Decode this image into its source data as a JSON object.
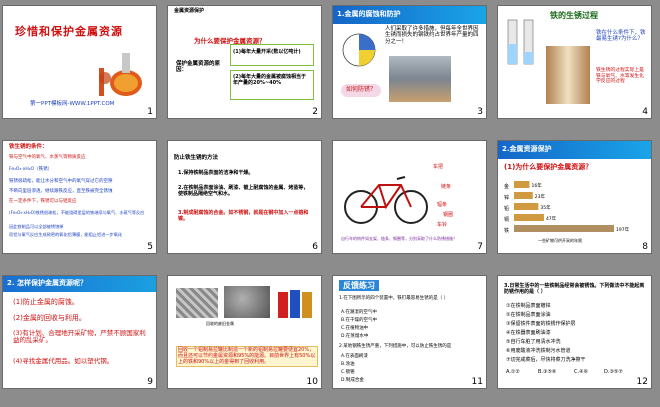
{
  "slides": [
    {
      "num": "1",
      "title": "珍惜和保护金属资源",
      "footer": "第一PPT模板网-WWW.1PPT.COM"
    },
    {
      "num": "2",
      "heading": "金属资源保护",
      "question": "为什么要保护金属资源？",
      "reason_label": "保护金属资源的原因：",
      "reason1": "(1)每年大量开采(数以亿吨计)",
      "reason2": "(2)每年大量的金属被腐蚀相当于年产量的20%~40%"
    },
    {
      "num": "3",
      "heading": "1.金属的腐蚀和防护",
      "text": "人们采取了许多措施，但每年全世界因生锈而损失的钢铁约占世界年产量的四分之一！",
      "callout": "如何防锈？"
    },
    {
      "num": "4",
      "heading": "铁的生锈过程",
      "q": "铁在什么条件下，铁最易生锈?为什么？",
      "caption": "铁生锈的过程实际上是铁与氧气、水等发生化学反应的过程"
    },
    {
      "num": "5",
      "heading": "铁生锈的条件：",
      "lines": [
        "铁与空气中的氧气、水蒸气等物质反应",
        "Fe₂O₃·xH₂O（铁锈）",
        "铁锈很疏松，能让水分和空气中的氧气穿过它的空隙",
        "不断向里层渗透，继续跟铁反应，直至铁被完全锈蚀",
        "在一定条件下，铁锈可以与铝反应",
        "(Fe₂O₃·xH₂O)铁锈很疏松，不能阻碍里层的铁继续与氧气、水蒸气等反应",
        "因此铁制品可以全部被锈蚀掉",
        "而铝与氧气反应生成致密的氧化铝薄膜，能阻止铝进一步氧化"
      ]
    },
    {
      "num": "6",
      "heading": "防止铁生锈的方法",
      "lines": [
        "1.保持铁制品表面的洁净和干燥。",
        "2.在铁制品表面涂油、刷漆、镀上耐腐蚀的金属、烤蓝等，使铁制品隔绝空气和水。",
        "3.制成耐腐蚀的合金。如不锈钢，就是在钢中加入一点铬和镍。"
      ]
    },
    {
      "num": "7",
      "labels": [
        "链条",
        "车把",
        "辐条",
        "钢圈",
        "车铃"
      ],
      "question": "自行车的构件如支架、链条、钢圈等，分别采取了什么防锈措施？"
    },
    {
      "num": "8",
      "heading": "2.金属资源保护",
      "question": "(1)为什么要保护金属资源？",
      "bars": [
        {
          "label": "金",
          "value": "16年"
        },
        {
          "label": "锌",
          "value": "23年"
        },
        {
          "label": "铅",
          "value": "35年"
        },
        {
          "label": "铜",
          "value": "47年"
        },
        {
          "label": "铁",
          "value": "197年"
        }
      ],
      "caption": "一些矿物可供开采的年限"
    },
    {
      "num": "9",
      "heading": "2. 怎样保护金属资源呢？",
      "items": [
        "(1)防止金属的腐蚀。",
        "(2)金属的回收与利用。",
        "(3)有计划、合理地开采矿物，严禁不顾国家利益的乱采矿。",
        "(4)寻找金属代用品。如以塑代钢。"
      ]
    },
    {
      "num": "10",
      "caption": "回收的废旧金属",
      "text": "回收一个铝制易拉罐比制造一个新的铝制易拉罐要便宜20%，而且还可以节约金属资源和95%的能源。目前世界上有50%以上的铁和90%以上的金得到了回收利用。"
    },
    {
      "num": "11",
      "heading": "反馈练习",
      "q1": "1.在下图所示的四个装置中，铁钉最容易生锈的是（ ）",
      "opts": [
        "A.在潮湿的空气中",
        "B.在干燥的空气中",
        "C.在植物油中",
        "D.在蒸馏水中"
      ],
      "q2": "2.某地钢铁生锈严重，下列措施中，可以防止铁生锈的是",
      "opts2": [
        "A.在表面刷漆",
        "B.涂油",
        "C.镀铬",
        "D.制成合金"
      ]
    },
    {
      "num": "12",
      "q": "3.日常生活中的一些铁制品经常会被锈蚀。下列做法中不能起到防锈作用的是（ ）",
      "items": [
        "①在铁制品表面镀锌",
        "②在铁制品表面涂油",
        "③保留铁件表面的铁锈作保护层",
        "④在铁器表面刷油漆",
        "⑤自行车脏了用清水冲洗",
        "⑥用废酸液冲洗铁制污水管道",
        "⑦切完咸菜后，尽快将菜刀洗净擦干"
      ],
      "opts": [
        "A.①②",
        "B.③⑤⑥",
        "C.④⑥",
        "D.③⑤⑦"
      ]
    }
  ],
  "colors": {
    "accent_red": "#d01010",
    "accent_blue": "#1a3fc0",
    "border_green": "#7fbf3a",
    "bg": "#8c8c8c"
  }
}
